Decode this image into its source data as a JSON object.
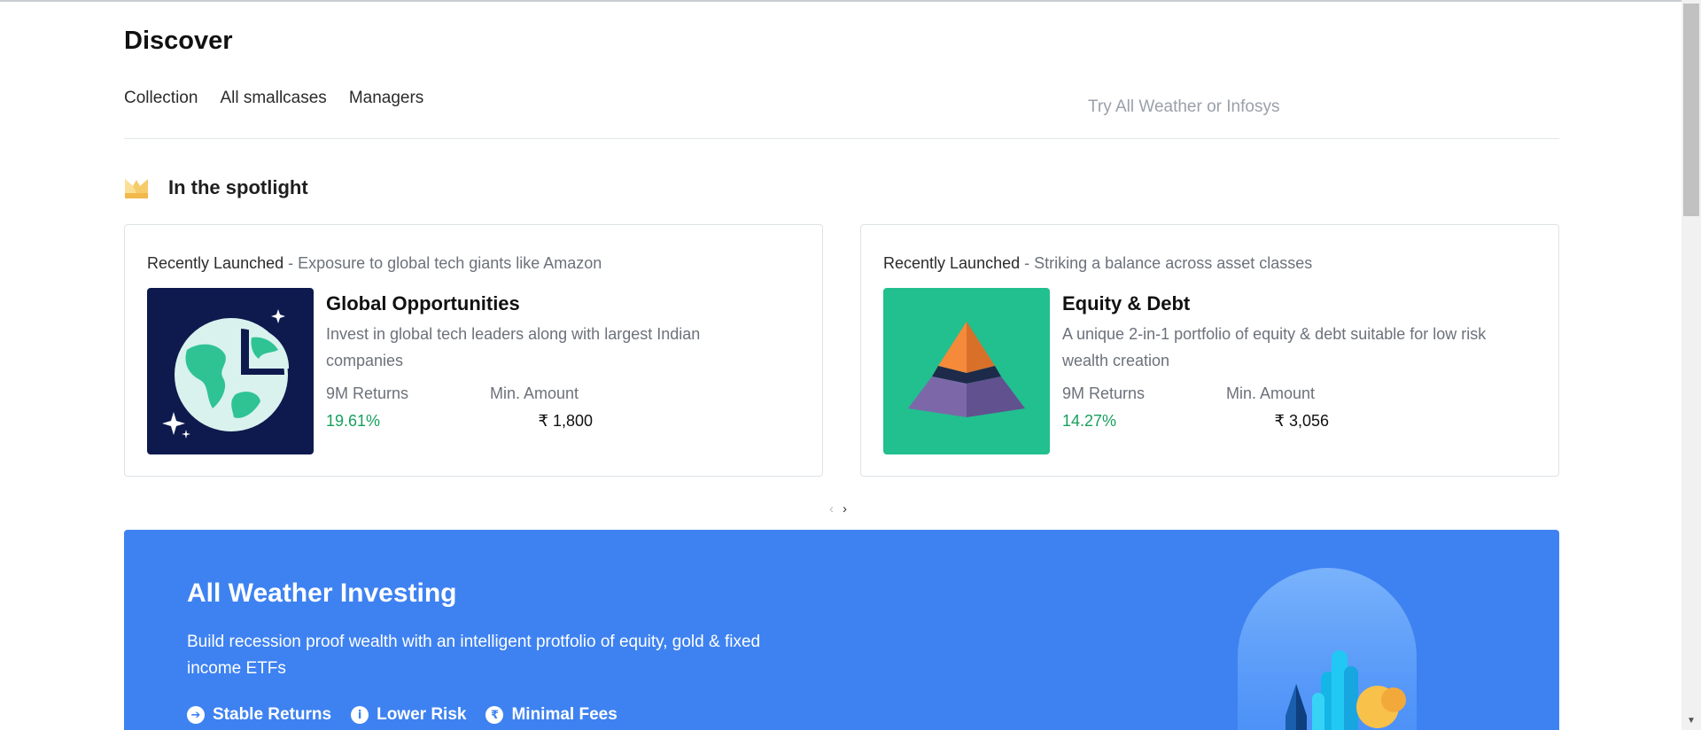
{
  "page": {
    "title": "Discover"
  },
  "tabs": [
    {
      "label": "Collection"
    },
    {
      "label": "All smallcases"
    },
    {
      "label": "Managers"
    }
  ],
  "search": {
    "placeholder": "Try All Weather or Infosys"
  },
  "spotlight": {
    "icon": "crown-icon",
    "title": "In the spotlight",
    "cards": [
      {
        "tag": "Recently Launched",
        "subtitle": " - Exposure to global tech giants like Amazon",
        "image": "globe-pie-icon",
        "name": "Global Opportunities",
        "description": "Invest in global tech leaders along with largest Indian companies",
        "returns_label": "9M Returns",
        "returns_value": "19.61%",
        "min_label": "Min. Amount",
        "min_value": "₹ 1,800"
      },
      {
        "tag": "Recently Launched",
        "subtitle": " - Striking a balance across asset classes",
        "image": "pyramid-icon",
        "name": "Equity & Debt",
        "description": "A unique 2-in-1 portfolio of equity & debt suitable for low risk wealth creation",
        "returns_label": "9M Returns",
        "returns_value": "14.27%",
        "min_label": "Min. Amount",
        "min_value": "₹ 3,056"
      }
    ]
  },
  "pager": {
    "prev": "‹",
    "next": "›"
  },
  "banner": {
    "title": "All Weather Investing",
    "description": "Build recession proof wealth with an intelligent protfolio of equity, gold & fixed income ETFs",
    "features": [
      {
        "icon": "arrow-right-circle-icon",
        "glyph": "➔",
        "label": "Stable Returns"
      },
      {
        "icon": "info-circle-icon",
        "glyph": "i",
        "label": "Lower Risk"
      },
      {
        "icon": "rupee-circle-icon",
        "glyph": "₹",
        "label": "Minimal Fees"
      }
    ]
  },
  "colors": {
    "accent_blue": "#3e82f1",
    "positive_green": "#16a05d",
    "muted_text": "#6c717a",
    "globe_bg": "#0e1a4e",
    "pyramid_bg": "#22bf8f"
  }
}
